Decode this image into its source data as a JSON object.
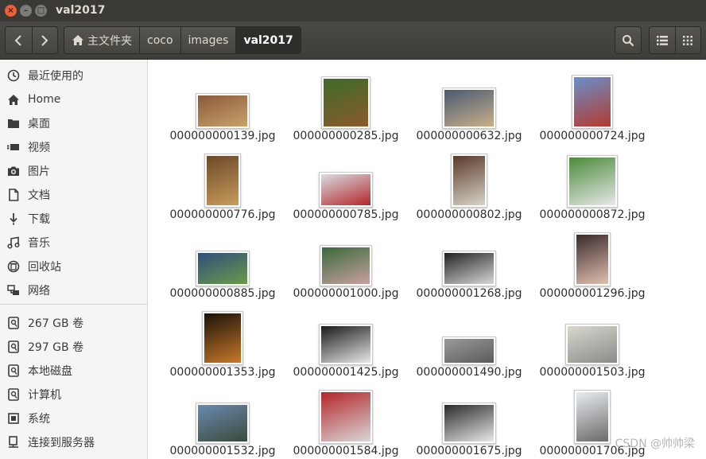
{
  "window": {
    "title": "val2017"
  },
  "toolbar": {
    "back_icon": "chevron-left-icon",
    "forward_icon": "chevron-right-icon",
    "breadcrumb": [
      {
        "label": "主文件夹",
        "icon": "home-icon"
      },
      {
        "label": "coco"
      },
      {
        "label": "images"
      },
      {
        "label": "val2017",
        "active": true
      }
    ],
    "search_icon": "search-icon",
    "list_view_icon": "list-view-icon",
    "grid_view_icon": "grid-view-icon"
  },
  "sidebar": {
    "items": [
      {
        "label": "最近使用的",
        "icon": "clock-icon"
      },
      {
        "label": "Home",
        "icon": "home-icon"
      },
      {
        "label": "桌面",
        "icon": "folder-icon"
      },
      {
        "label": "视频",
        "icon": "video-icon"
      },
      {
        "label": "图片",
        "icon": "camera-icon"
      },
      {
        "label": "文档",
        "icon": "document-icon"
      },
      {
        "label": "下载",
        "icon": "download-icon"
      },
      {
        "label": "音乐",
        "icon": "music-icon"
      },
      {
        "label": "回收站",
        "icon": "trash-icon"
      },
      {
        "label": "网络",
        "icon": "network-icon"
      }
    ],
    "devices": [
      {
        "label": "267 GB 卷",
        "icon": "drive-icon"
      },
      {
        "label": "297 GB 卷",
        "icon": "drive-icon"
      },
      {
        "label": "本地磁盘",
        "icon": "drive-icon"
      },
      {
        "label": "计算机",
        "icon": "drive-icon"
      },
      {
        "label": "系统",
        "icon": "chip-icon"
      },
      {
        "label": "连接到服务器",
        "icon": "server-icon"
      }
    ]
  },
  "files": [
    {
      "name": "000000000139.jpg",
      "colors": [
        "#8a5a3a",
        "#c9a26b"
      ]
    },
    {
      "name": "000000000285.jpg",
      "colors": [
        "#3d6b2a",
        "#8b5a2b"
      ]
    },
    {
      "name": "000000000632.jpg",
      "colors": [
        "#4a5a72",
        "#c8b08a"
      ]
    },
    {
      "name": "000000000724.jpg",
      "colors": [
        "#6a8fc9",
        "#b33a2e"
      ]
    },
    {
      "name": "000000000776.jpg",
      "colors": [
        "#6b4a2a",
        "#c99a5a"
      ]
    },
    {
      "name": "000000000785.jpg",
      "colors": [
        "#d8dde2",
        "#b3262a"
      ]
    },
    {
      "name": "000000000802.jpg",
      "colors": [
        "#5a3a2a",
        "#d8d3c8"
      ]
    },
    {
      "name": "000000000872.jpg",
      "colors": [
        "#4a8a3a",
        "#e8e8e8"
      ]
    },
    {
      "name": "000000000885.jpg",
      "colors": [
        "#2e4f7a",
        "#6a9a4a"
      ]
    },
    {
      "name": "000000001000.jpg",
      "colors": [
        "#3a6a3a",
        "#c8a0a0"
      ]
    },
    {
      "name": "000000001268.jpg",
      "colors": [
        "#222222",
        "#d8d8d8"
      ]
    },
    {
      "name": "000000001296.jpg",
      "colors": [
        "#3a2a2a",
        "#e0c0b0"
      ]
    },
    {
      "name": "000000001353.jpg",
      "colors": [
        "#1a1208",
        "#c8782a"
      ]
    },
    {
      "name": "000000001425.jpg",
      "colors": [
        "#1a1a1a",
        "#e8e8e8"
      ]
    },
    {
      "name": "000000001490.jpg",
      "colors": [
        "#9a9a9a",
        "#5a5a5a"
      ]
    },
    {
      "name": "000000001503.jpg",
      "colors": [
        "#d8d8d0",
        "#8a8a88"
      ]
    },
    {
      "name": "000000001532.jpg",
      "colors": [
        "#6a8ab0",
        "#3a4a3a"
      ]
    },
    {
      "name": "000000001584.jpg",
      "colors": [
        "#b3262a",
        "#d8d8d8"
      ]
    },
    {
      "name": "000000001675.jpg",
      "colors": [
        "#2a2a2a",
        "#e8e8e8"
      ]
    },
    {
      "name": "000000001706.jpg",
      "colors": [
        "#e8ecf0",
        "#6a6a6a"
      ]
    }
  ],
  "watermark": "CSDN @帅帅梁"
}
